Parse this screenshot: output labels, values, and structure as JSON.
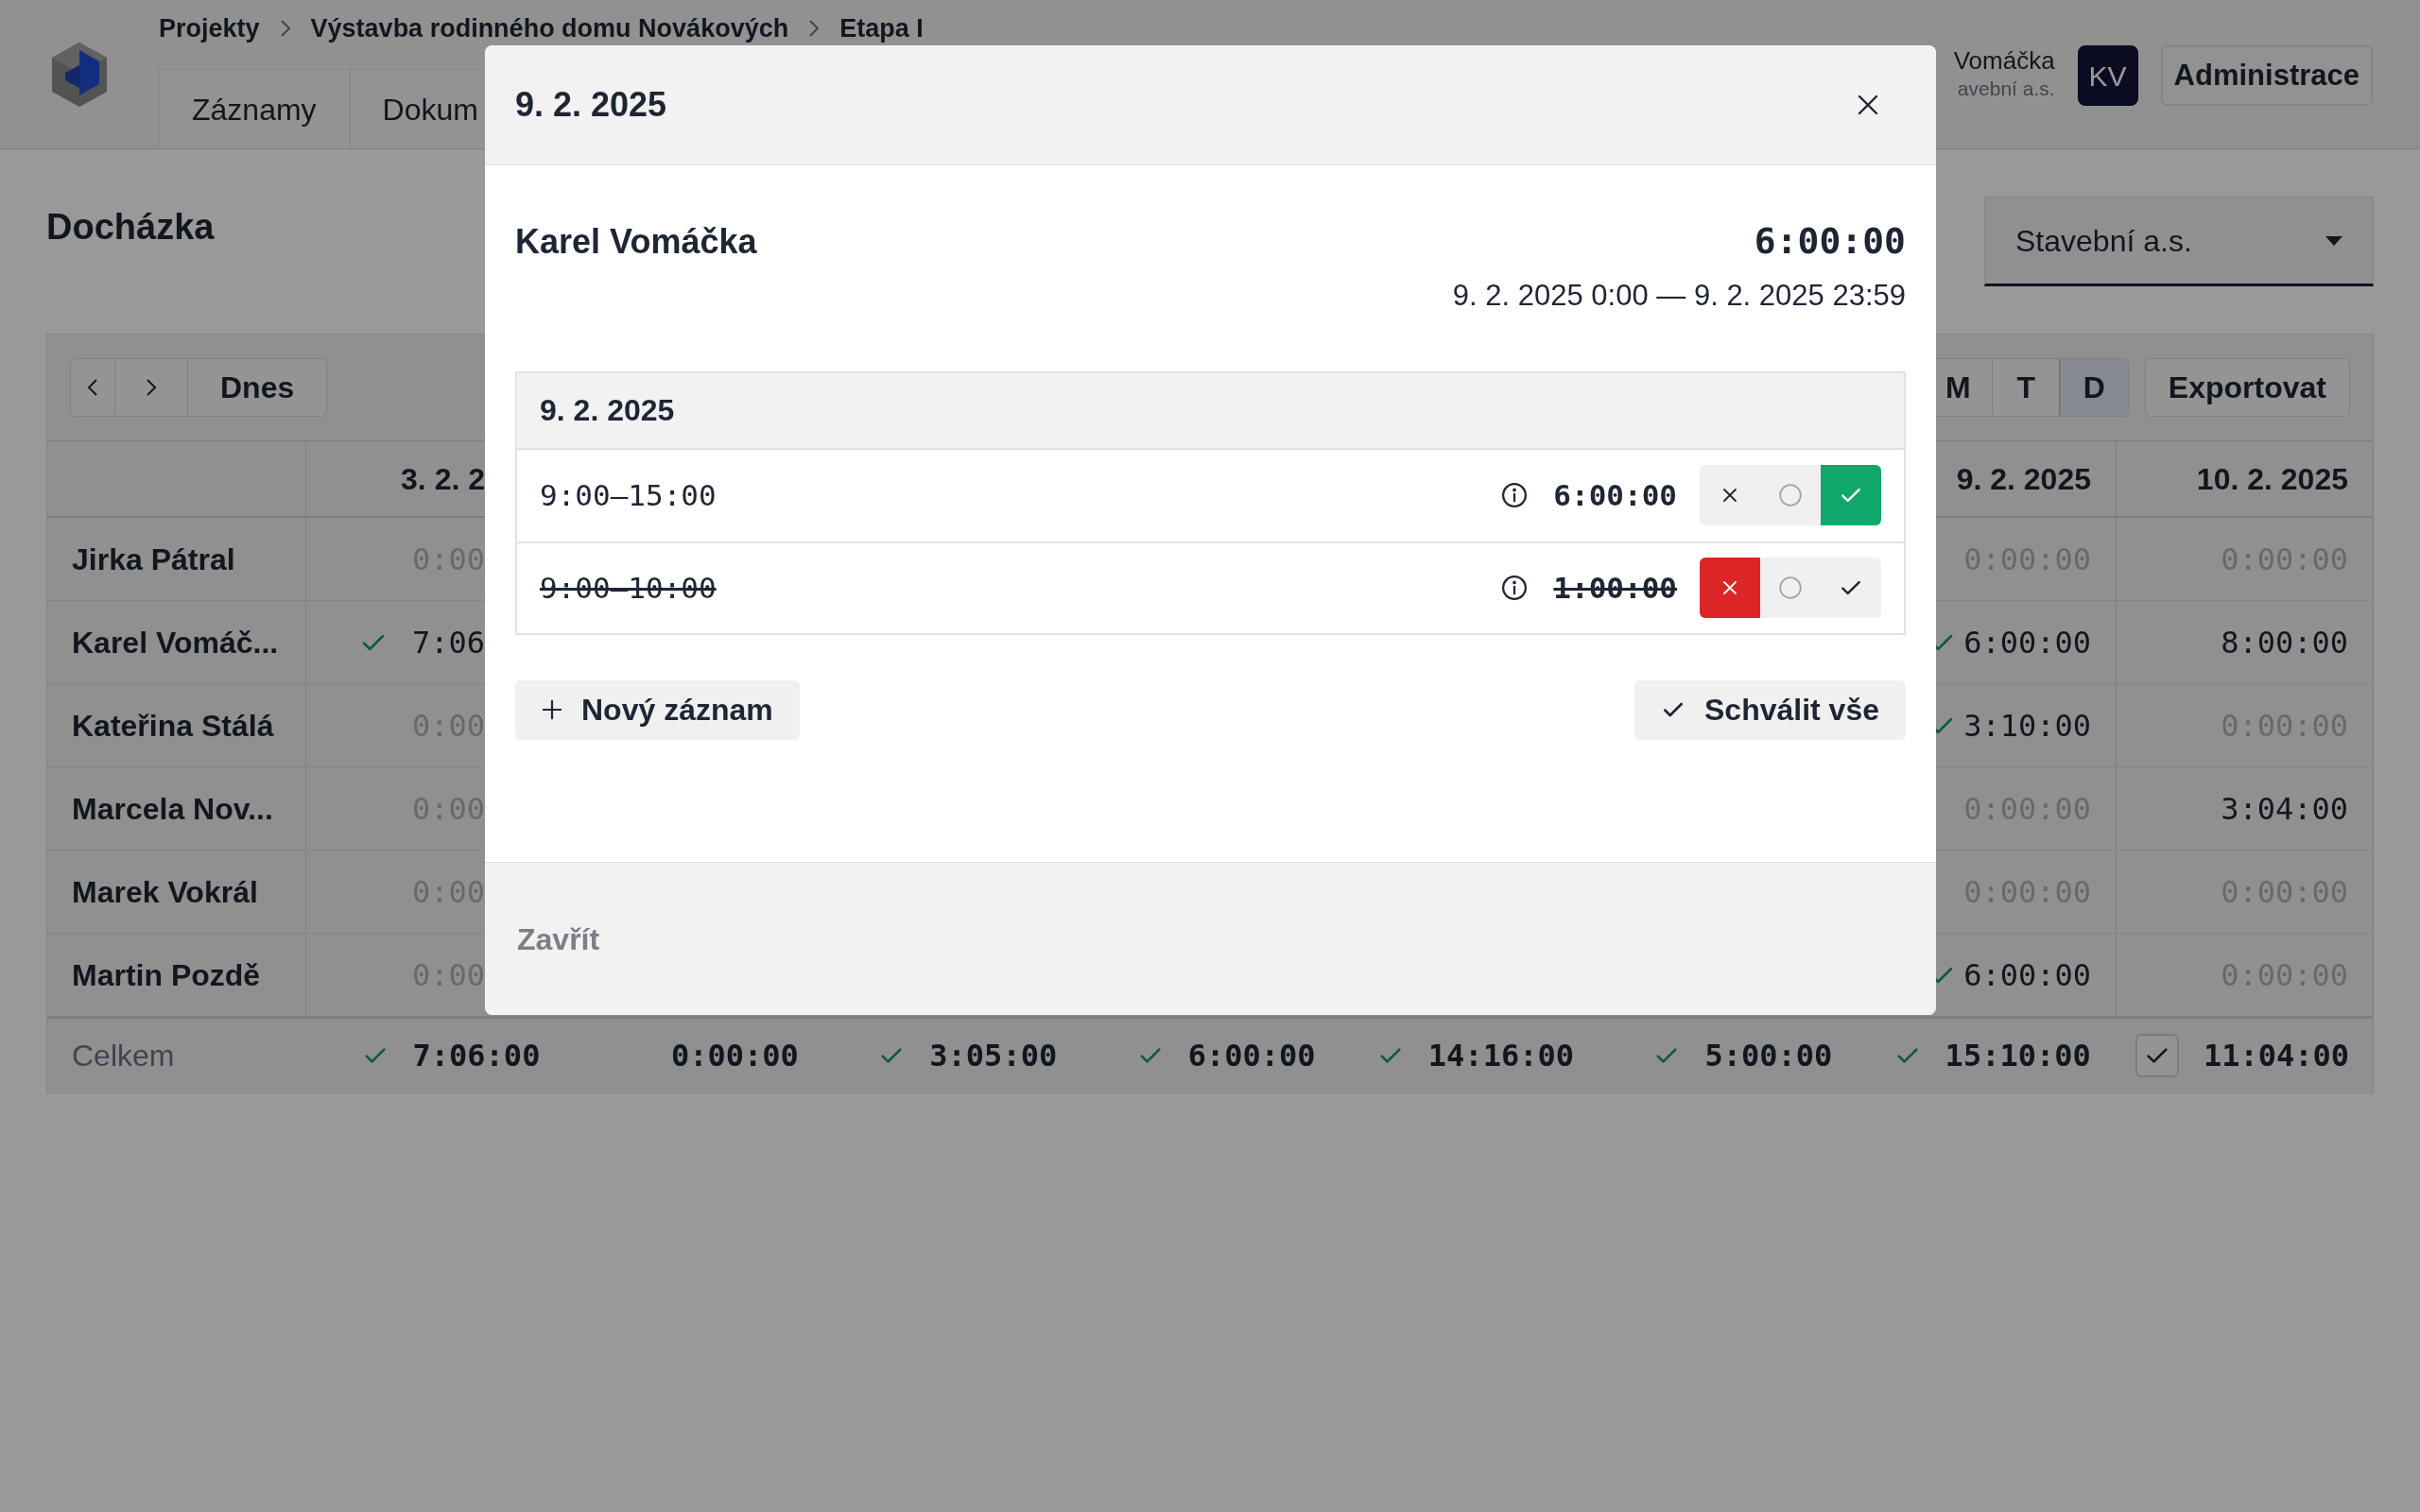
{
  "header": {
    "breadcrumbs": [
      "Projekty",
      "Výstavba rodinného domu Novákových",
      "Etapa I"
    ],
    "tabs": [
      {
        "label": "Záznamy"
      },
      {
        "label": "Dokum"
      }
    ],
    "user": {
      "name": "Vomáčka",
      "company": "avební a.s.",
      "initials": "KV"
    },
    "admin_button": "Administrace"
  },
  "page": {
    "title": "Docházka",
    "company_select": {
      "value": "Stavební a.s."
    }
  },
  "toolbar": {
    "today": "Dnes",
    "views": [
      {
        "label": "M",
        "selected": false
      },
      {
        "label": "T",
        "selected": false
      },
      {
        "label": "D",
        "selected": true
      }
    ],
    "export": "Exportovat"
  },
  "table": {
    "columns": [
      {
        "label": "3. 2. 2"
      },
      {
        "label": "9. 2. 2025"
      },
      {
        "label": "10. 2. 2025"
      }
    ],
    "rows": [
      {
        "name": "Jirka Pátral",
        "cells": [
          {
            "value": "0:00",
            "zero": true,
            "approved": false
          },
          {
            "value": "0:00:00",
            "zero": true,
            "approved": false
          },
          {
            "value": "0:00:00",
            "zero": true,
            "approved": false
          }
        ]
      },
      {
        "name": "Karel Vomáč...",
        "cells": [
          {
            "value": "7:06",
            "zero": false,
            "approved": true
          },
          {
            "value": "6:00:00",
            "zero": false,
            "approved": true
          },
          {
            "value": "8:00:00",
            "zero": false,
            "approved": false
          }
        ]
      },
      {
        "name": "Kateřina Stálá",
        "cells": [
          {
            "value": "0:00",
            "zero": true,
            "approved": false
          },
          {
            "value": "3:10:00",
            "zero": false,
            "approved": true
          },
          {
            "value": "0:00:00",
            "zero": true,
            "approved": false
          }
        ]
      },
      {
        "name": "Marcela Nov...",
        "cells": [
          {
            "value": "0:00",
            "zero": true,
            "approved": false
          },
          {
            "value": "0:00:00",
            "zero": true,
            "approved": false
          },
          {
            "value": "3:04:00",
            "zero": false,
            "approved": false
          }
        ]
      },
      {
        "name": "Marek Vokrál",
        "cells": [
          {
            "value": "0:00",
            "zero": true,
            "approved": false
          },
          {
            "value": "0:00:00",
            "zero": true,
            "approved": false
          },
          {
            "value": "0:00:00",
            "zero": true,
            "approved": false
          }
        ]
      },
      {
        "name": "Martin Pozdě",
        "cells": [
          {
            "value": "0:00",
            "zero": true,
            "approved": false
          },
          {
            "value": "6:00:00",
            "zero": false,
            "approved": true
          },
          {
            "value": "0:00:00",
            "zero": true,
            "approved": false
          }
        ]
      }
    ],
    "total": {
      "label": "Celkem",
      "values": [
        {
          "value": "7:06:00",
          "kind": "mark",
          "approved": true
        },
        {
          "value": "0:00:00",
          "kind": "mark",
          "approved": false
        },
        {
          "value": "3:05:00",
          "kind": "mark",
          "approved": true
        },
        {
          "value": "6:00:00",
          "kind": "mark",
          "approved": true
        },
        {
          "value": "14:16:00",
          "kind": "mark",
          "approved": true
        },
        {
          "value": "5:00:00",
          "kind": "mark",
          "approved": true
        },
        {
          "value": "15:10:00",
          "kind": "mark",
          "approved": true
        },
        {
          "value": "11:04:00",
          "kind": "checkbox",
          "approved": false
        }
      ]
    }
  },
  "modal": {
    "title": "9. 2. 2025",
    "person": "Karel Vomáčka",
    "total": "6:00:00",
    "range": "9. 2. 2025 0:00 — 9. 2. 2025 23:59",
    "day": "9. 2. 2025",
    "entries": [
      {
        "time": "9:00–15:00",
        "duration": "6:00:00",
        "approved": true,
        "rejected": false
      },
      {
        "time": "9:00–10:00",
        "duration": "1:00:00",
        "approved": false,
        "rejected": true
      }
    ],
    "new_button": "Nový záznam",
    "approve_all_button": "Schválit vše",
    "close_button": "Zavřít"
  }
}
